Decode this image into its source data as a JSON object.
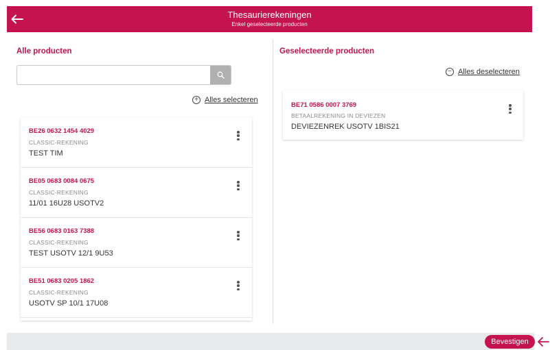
{
  "header": {
    "title": "Thesaurierekeningen",
    "subtitle": "Enkel geselecteerde producten",
    "background": "#c4134e"
  },
  "all_products": {
    "title": "Alle producten",
    "search": {
      "value": "",
      "placeholder": ""
    },
    "select_all_label": "Alles selecteren",
    "items": [
      {
        "iban": "BE26 0632 1454 4029",
        "type": "CLASSIC-REKENING",
        "name": "TEST TIM"
      },
      {
        "iban": "BE05 0683 0084 0675",
        "type": "CLASSIC-REKENING",
        "name": "11/01 16U28 USOTV2"
      },
      {
        "iban": "BE56 0683 0163 7388",
        "type": "CLASSIC-REKENING",
        "name": "TEST USOTV 12/1 9U53"
      },
      {
        "iban": "BE51 0683 0205 1862",
        "type": "CLASSIC-REKENING",
        "name": "USOTV SP 10/1 17U08"
      }
    ]
  },
  "selected_products": {
    "title": "Geselecteerde producten",
    "deselect_all_label": "Alles deselecteren",
    "items": [
      {
        "iban": "BE71 0586 0007 3769",
        "type": "BETAALREKENING IN DEVIEZEN",
        "name": "DEVIEZENREK USOTV 1BIS21"
      }
    ]
  },
  "footer": {
    "confirm_label": "Bevestigen"
  },
  "icons": {
    "back": "arrow-left-icon",
    "search": "search-icon",
    "select_all": "plus-circle-icon",
    "deselect_all": "minus-circle-icon",
    "more": "kebab-menu-icon",
    "pointer": "arrow-left-icon"
  },
  "colors": {
    "accent": "#c4134e",
    "footer_bg": "#e7e9ed"
  }
}
